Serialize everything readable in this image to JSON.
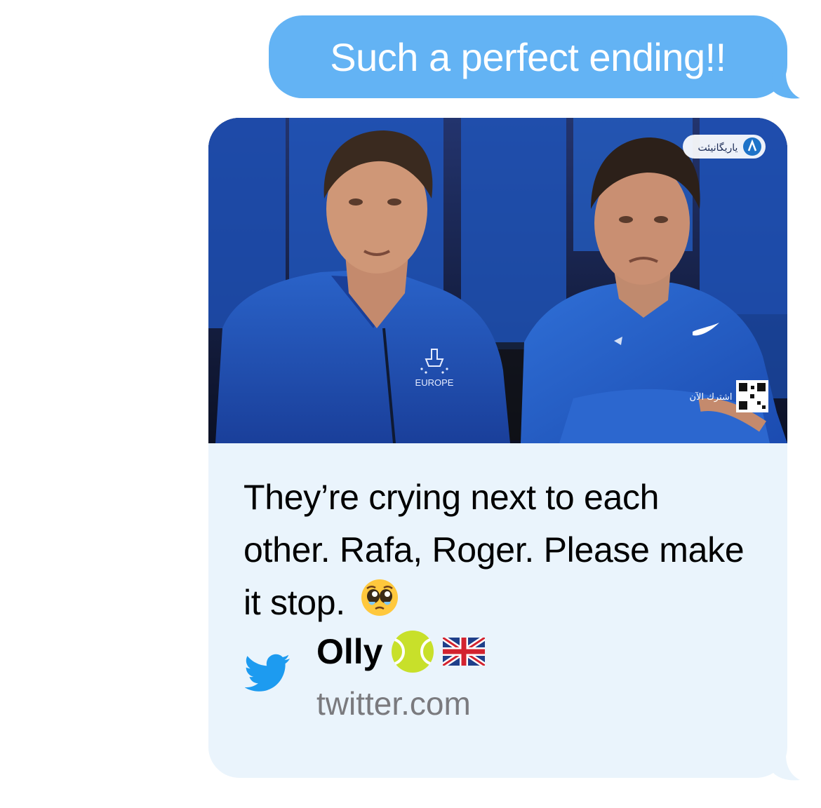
{
  "message": {
    "text": "Such a perfect ending!!",
    "bubble_color": "#63b3f4",
    "text_color": "#ffffff"
  },
  "link_preview": {
    "background_color": "#eaf4fc",
    "image": {
      "description_icon": "tennis-players-photo",
      "jacket_logo_text": "EUROPE",
      "watermark_text": "یاریگانیئت",
      "overlay_text": "اشترك الآن",
      "qr_icon": "qr-code-icon"
    },
    "title": "They’re crying next to each other. Rafa, Roger. Please make it stop.",
    "title_emoji": "pleading-face-emoji",
    "author": {
      "name": "Olly",
      "emoji_1": "tennis-ball-emoji",
      "emoji_2": "uk-flag-emoji"
    },
    "domain": "twitter.com",
    "site_icon": "twitter-bird-icon",
    "twitter_color": "#1d9bf0"
  }
}
